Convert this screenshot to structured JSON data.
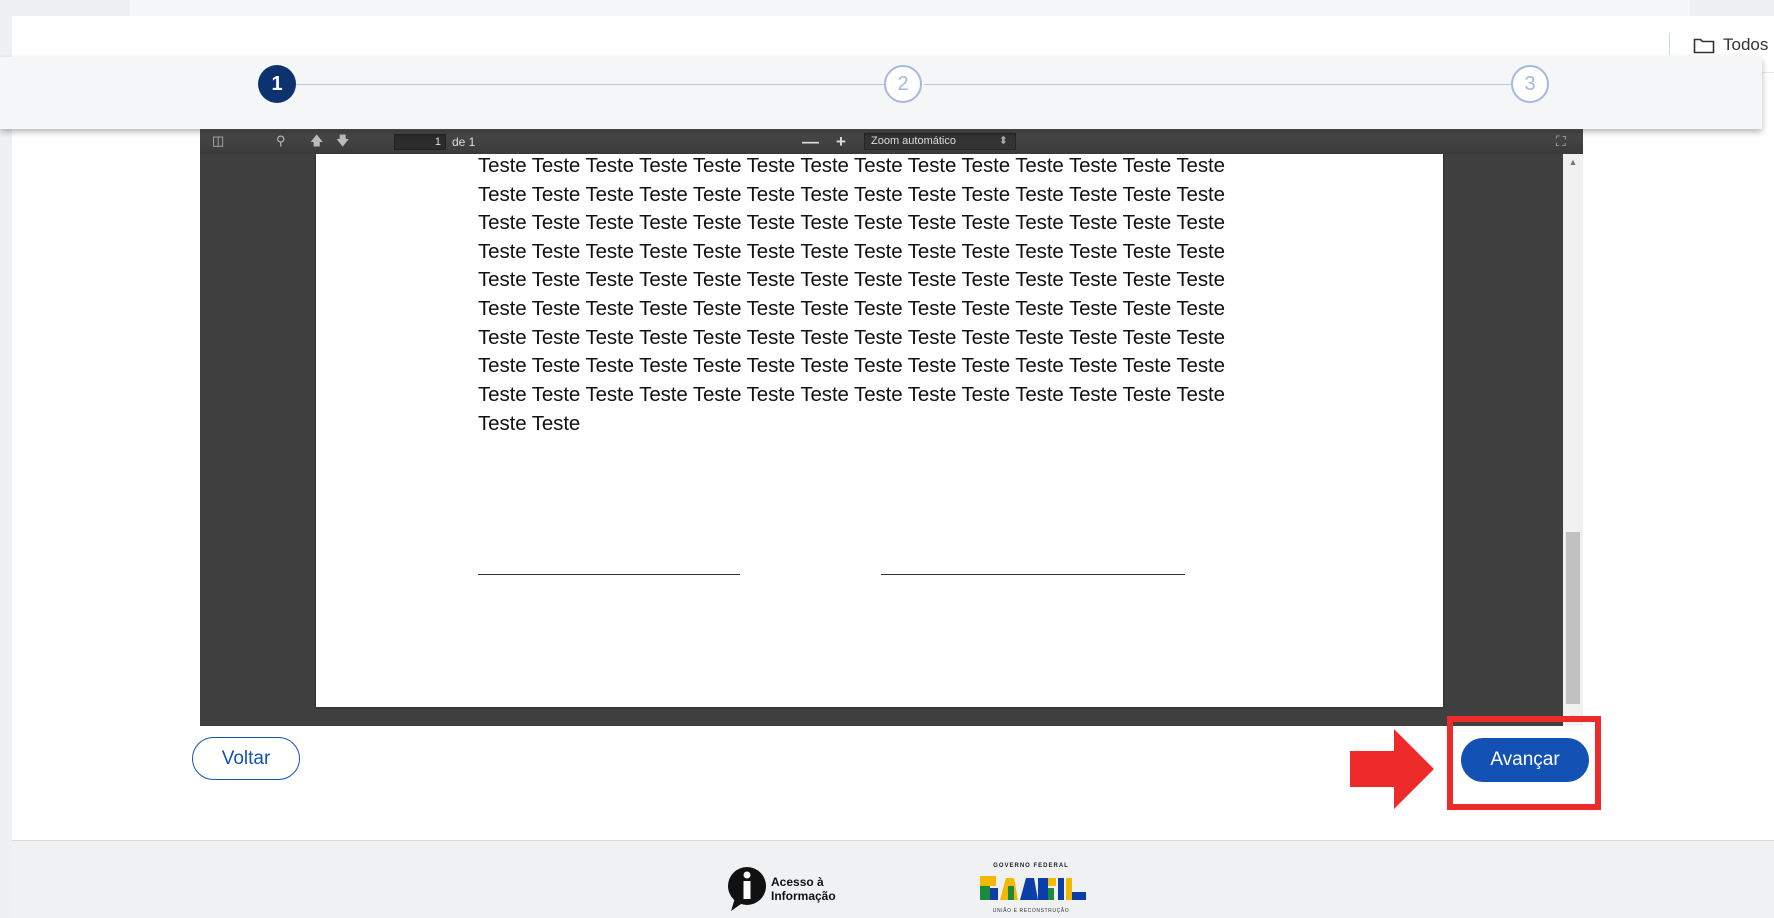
{
  "header": {
    "folder_label": "Todos"
  },
  "stepper": {
    "steps": [
      {
        "label": "1",
        "state": "active"
      },
      {
        "label": "2",
        "state": "inactive"
      },
      {
        "label": "3",
        "state": "inactive"
      }
    ]
  },
  "pdf_viewer": {
    "page_number": "1",
    "page_of": "de 1",
    "zoom_minus": "—",
    "zoom_plus": "+",
    "zoom_value": "Zoom automático",
    "document_lines": [
      "Teste Teste Teste Teste Teste Teste Teste Teste Teste Teste Teste Teste Teste Teste",
      "Teste Teste Teste Teste Teste Teste Teste Teste Teste Teste Teste Teste Teste Teste",
      "Teste Teste Teste Teste Teste Teste Teste Teste Teste Teste Teste Teste Teste Teste",
      "Teste Teste Teste Teste Teste Teste Teste Teste Teste Teste Teste Teste Teste Teste",
      "Teste Teste Teste Teste Teste Teste Teste Teste Teste Teste Teste Teste Teste Teste",
      "Teste Teste Teste Teste Teste Teste Teste Teste Teste Teste Teste Teste Teste Teste",
      "Teste Teste Teste Teste Teste Teste Teste Teste Teste Teste Teste Teste Teste Teste",
      "Teste Teste Teste Teste Teste Teste Teste Teste Teste Teste Teste Teste Teste Teste",
      "Teste Teste Teste Teste Teste Teste Teste Teste Teste Teste Teste Teste Teste Teste",
      "Teste Teste"
    ]
  },
  "actions": {
    "back_label": "Voltar",
    "next_label": "Avançar"
  },
  "footer": {
    "lai_line1": "Acesso à",
    "lai_line2": "Informação",
    "gov_top": "GOVERNO FEDERAL",
    "gov_brand": "BRASIL",
    "gov_bottom": "UNIÃO E RECONSTRUÇÃO"
  },
  "colors": {
    "primary": "#1351b4",
    "step_active": "#0c326f",
    "highlight": "#ee2b2b"
  }
}
